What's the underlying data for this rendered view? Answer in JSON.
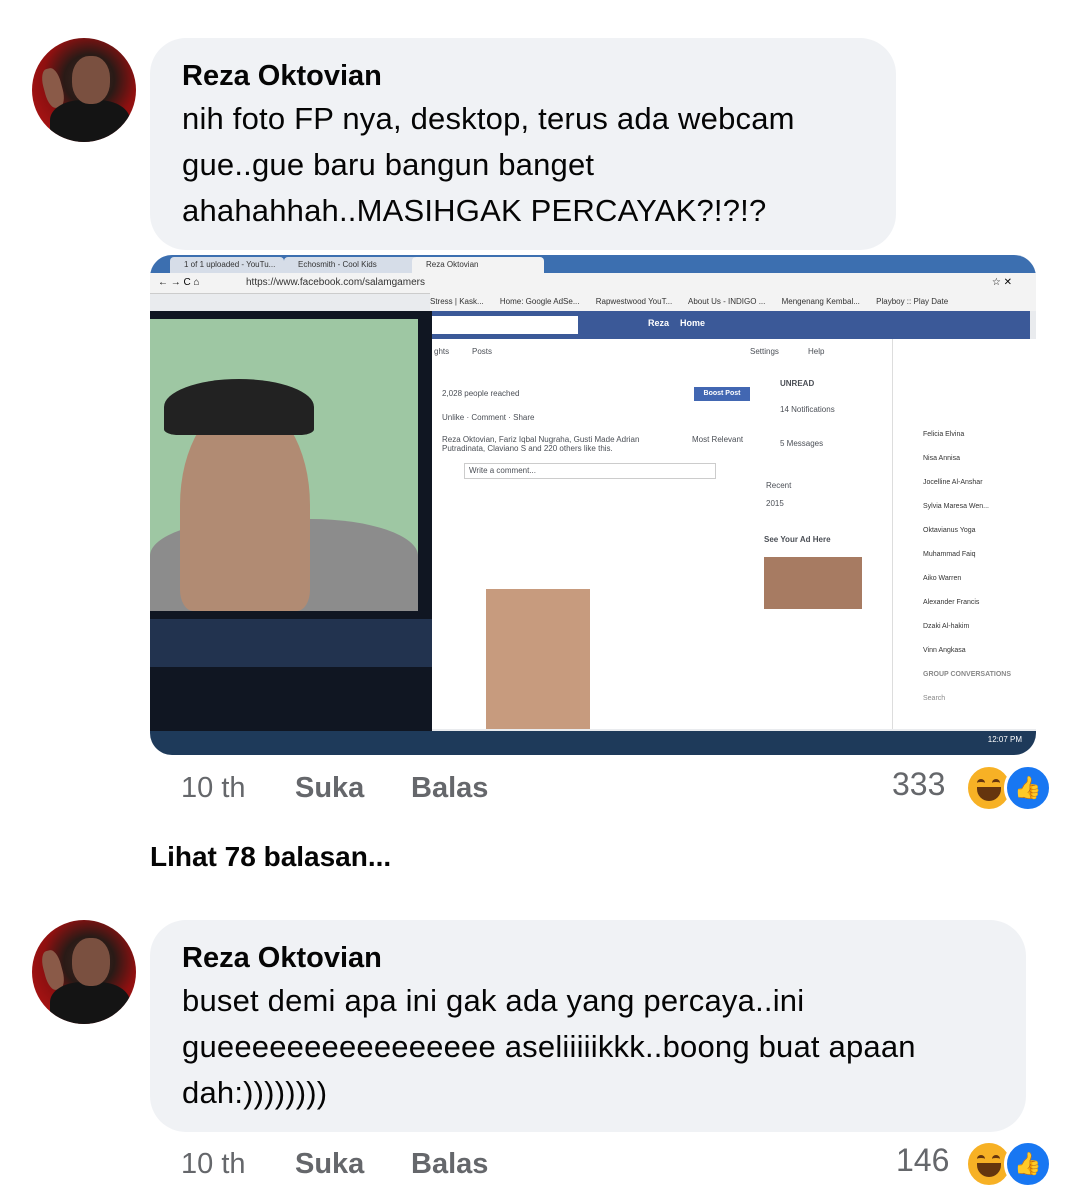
{
  "comments": [
    {
      "author": "Reza Oktovian",
      "lines": [
        "nih foto FP nya, desktop, terus ada webcam",
        "gue..gue baru bangun banget",
        "ahahahhah..MASIHGAK PERCAYAK?!?!?"
      ],
      "time": "10 th",
      "like_label": "Suka",
      "reply_label": "Balas",
      "reaction_count": "333",
      "reactions": [
        "haha-icon",
        "like-icon"
      ]
    },
    {
      "author": "Reza Oktovian",
      "lines": [
        "buset demi apa ini gak ada yang percaya..ini",
        "gueeeeeeeeeeeeeeee aseliiiiikkk..boong buat apaan",
        "dah:))))))))"
      ],
      "time": "10 th",
      "like_label": "Suka",
      "reply_label": "Balas",
      "reaction_count": "146",
      "reactions": [
        "haha-icon",
        "like-icon"
      ]
    }
  ],
  "see_replies": "Lihat 78 balasan...",
  "screenshot": {
    "tabs": [
      "1 of 1 uploaded - YouTu...",
      "Echosmith - Cool Kids",
      "Reza Oktovian"
    ],
    "url": "https://www.facebook.com/salamgamers",
    "bookmarks": [
      "Stress | Kask...",
      "Home: Google AdSe...",
      "Rapwestwood YouT...",
      "About Us - INDIGO ...",
      "Mengenang Kembal...",
      "Playboy :: Play Date"
    ],
    "fb_name": "Reza",
    "fb_home": "Home",
    "tabs_row": [
      "ghts",
      "Posts",
      "Settings",
      "Help"
    ],
    "reached": "2,028 people reached",
    "boost": "Boost Post",
    "actions": "Unlike · Comment · Share",
    "likes_line": "Reza Oktovian, Fariz Iqbal Nugraha, Gusti Made Adrian Putradinata, Claviano S and 220 others like this.",
    "most_relevant": "Most Relevant",
    "write_comment": "Write a comment...",
    "unread": "UNREAD",
    "notifications": "14 Notifications",
    "messages": "5 Messages",
    "recent": "Recent",
    "year": "2015",
    "see_ad": "See Your Ad Here",
    "chat": [
      "Felicia Elvina",
      "Nisa Annisa",
      "Jocelline Al-Anshar",
      "Sylvia Maresa Wen...",
      "Oktavianus Yoga",
      "Muhammad Faiq",
      "Aiko Warren",
      "Alexander Francis",
      "Dzaki Al-hakim",
      "Vinn Angkasa"
    ],
    "group_conv": "GROUP CONVERSATIONS",
    "search": "Search",
    "clock": "12:07 PM"
  }
}
